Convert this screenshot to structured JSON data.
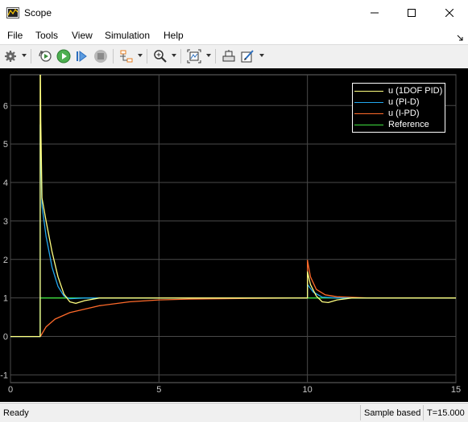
{
  "window": {
    "title": "Scope"
  },
  "menu": {
    "items": [
      "File",
      "Tools",
      "View",
      "Simulation",
      "Help"
    ]
  },
  "toolbar": {
    "icons": [
      "gear-icon",
      "restore-initial-icon",
      "run-icon",
      "step-forward-icon",
      "stop-icon",
      "signal-selector-icon",
      "zoom-icon",
      "autoscale-icon",
      "highlight-icon",
      "edit-icon"
    ]
  },
  "chart_data": {
    "type": "line",
    "xlim": [
      0,
      15
    ],
    "ylim": [
      -1.2,
      6.8
    ],
    "x_ticks": [
      "0",
      "5",
      "10",
      "15"
    ],
    "y_ticks": [
      "-1",
      "0",
      "1",
      "2",
      "3",
      "4",
      "5",
      "6"
    ],
    "grid": true,
    "legend_position": "top-right",
    "series": [
      {
        "name": "u (1DOF PID)",
        "color": "#ffff80",
        "points": [
          [
            0,
            0
          ],
          [
            1,
            0
          ],
          [
            1,
            6.8
          ],
          [
            1.01,
            6.8
          ],
          [
            1.02,
            5.6
          ],
          [
            1.06,
            3.6
          ],
          [
            1.2,
            3.0
          ],
          [
            1.4,
            2.2
          ],
          [
            1.6,
            1.55
          ],
          [
            1.8,
            1.1
          ],
          [
            2.0,
            0.9
          ],
          [
            2.2,
            0.86
          ],
          [
            2.5,
            0.93
          ],
          [
            3.0,
            1.0
          ],
          [
            5,
            1.0
          ],
          [
            10,
            1.0
          ],
          [
            10,
            1.68
          ],
          [
            10.1,
            1.35
          ],
          [
            10.3,
            1.05
          ],
          [
            10.5,
            0.9
          ],
          [
            10.7,
            0.88
          ],
          [
            11.0,
            0.95
          ],
          [
            11.5,
            1.0
          ],
          [
            15,
            1.0
          ]
        ]
      },
      {
        "name": "u (PI-D)",
        "color": "#22a8f0",
        "points": [
          [
            0,
            0
          ],
          [
            1,
            0
          ],
          [
            1,
            5.5
          ],
          [
            1.06,
            3.4
          ],
          [
            1.2,
            2.6
          ],
          [
            1.4,
            1.8
          ],
          [
            1.6,
            1.3
          ],
          [
            1.8,
            1.05
          ],
          [
            2.0,
            0.98
          ],
          [
            2.5,
            1.0
          ],
          [
            5,
            1.0
          ],
          [
            10,
            1.0
          ],
          [
            10,
            1.35
          ],
          [
            10.2,
            1.15
          ],
          [
            10.5,
            1.02
          ],
          [
            11,
            1.0
          ],
          [
            15,
            1.0
          ]
        ]
      },
      {
        "name": "u (I-PD)",
        "color": "#ff6a2a",
        "points": [
          [
            0,
            0
          ],
          [
            1,
            0
          ],
          [
            1.01,
            0
          ],
          [
            1.2,
            0.25
          ],
          [
            1.5,
            0.45
          ],
          [
            2.0,
            0.62
          ],
          [
            3.0,
            0.8
          ],
          [
            4.0,
            0.9
          ],
          [
            5.0,
            0.95
          ],
          [
            6.0,
            0.97
          ],
          [
            8.0,
            0.99
          ],
          [
            10,
            1.0
          ],
          [
            10,
            1.98
          ],
          [
            10.1,
            1.55
          ],
          [
            10.3,
            1.22
          ],
          [
            10.6,
            1.08
          ],
          [
            11.0,
            1.03
          ],
          [
            12,
            1.0
          ],
          [
            15,
            1.0
          ]
        ]
      },
      {
        "name": "Reference",
        "color": "#40e040",
        "points": [
          [
            0,
            0
          ],
          [
            1,
            0
          ],
          [
            1,
            1.0
          ],
          [
            15,
            1.0
          ]
        ]
      }
    ]
  }
}
